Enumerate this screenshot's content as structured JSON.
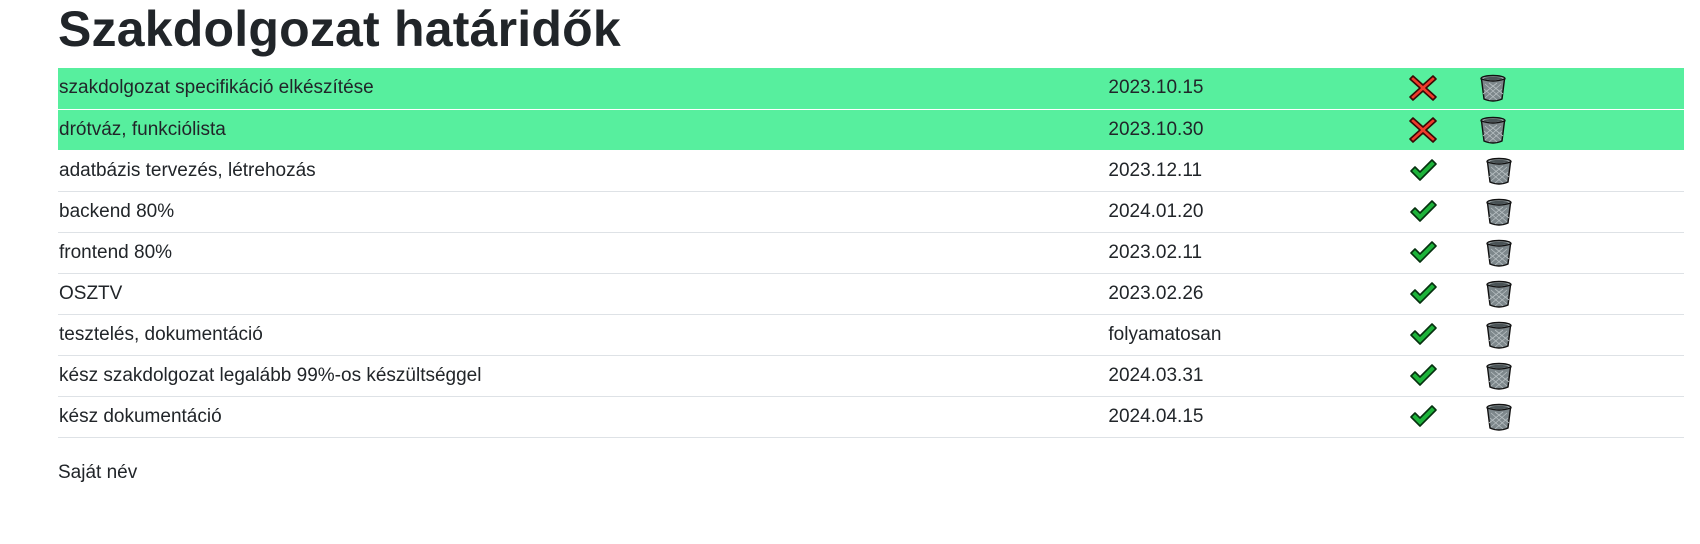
{
  "page": {
    "title": "Szakdolgozat határidők",
    "footer_name": "Saját név"
  },
  "colors": {
    "done_row_bg": "#57ef9e",
    "text": "#212529",
    "divider": "#dee2e6",
    "cross_red": "#ef3b2c",
    "check_green": "#1db33a",
    "trash_gray": "#8d9699"
  },
  "tasks": [
    {
      "label": "szakdolgozat specifikáció elkészítése",
      "date": "2023.10.15",
      "done": true,
      "status_icon": "red-x-icon"
    },
    {
      "label": "drótváz, funkciólista",
      "date": "2023.10.30",
      "done": true,
      "status_icon": "red-x-icon"
    },
    {
      "label": "adatbázis tervezés, létrehozás",
      "date": "2023.12.11",
      "done": false,
      "status_icon": "green-check-icon"
    },
    {
      "label": "backend 80%",
      "date": "2024.01.20",
      "done": false,
      "status_icon": "green-check-icon"
    },
    {
      "label": "frontend 80%",
      "date": "2023.02.11",
      "done": false,
      "status_icon": "green-check-icon"
    },
    {
      "label": "OSZTV",
      "date": "2023.02.26",
      "done": false,
      "status_icon": "green-check-icon"
    },
    {
      "label": "tesztelés, dokumentáció",
      "date": "folyamatosan",
      "done": false,
      "status_icon": "green-check-icon"
    },
    {
      "label": "kész szakdolgozat legalább 99%-os készültséggel",
      "date": "2024.03.31",
      "done": false,
      "status_icon": "green-check-icon"
    },
    {
      "label": "kész dokumentáció",
      "date": "2024.04.15",
      "done": false,
      "status_icon": "green-check-icon"
    }
  ]
}
